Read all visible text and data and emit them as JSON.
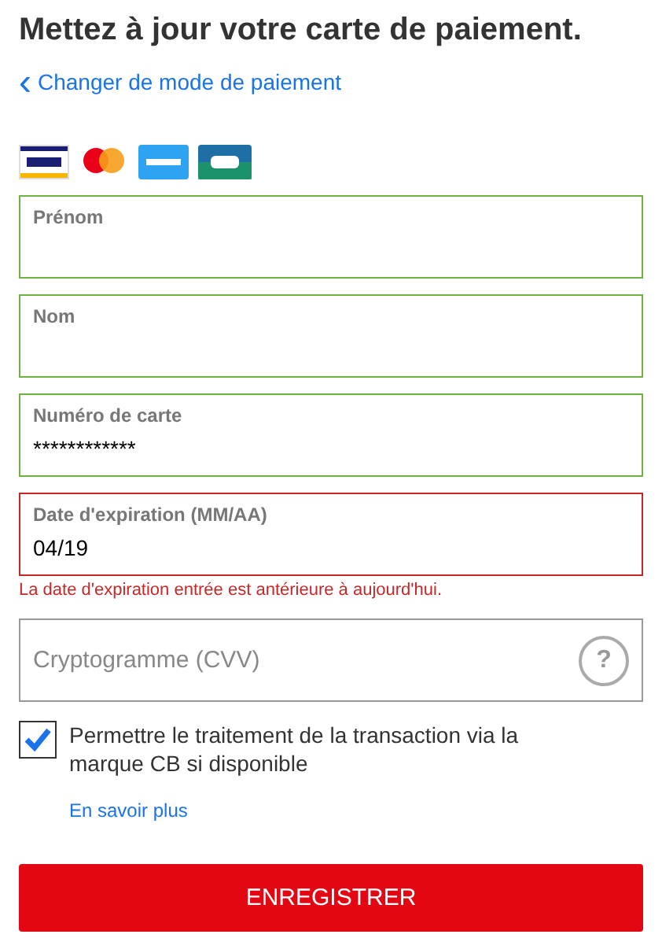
{
  "title": "Mettez à jour votre carte de paiement.",
  "back_link": {
    "icon": "‹",
    "label": "Changer de mode de paiement"
  },
  "fields": [
    {
      "label": "Prénom",
      "valid": true,
      "invalid": false
    },
    {
      "label": "Nom",
      "valid": true,
      "invalid": false
    },
    {
      "label": "Numéro de carte",
      "value": "************",
      "valid": true,
      "invalid": false
    },
    {
      "label": "Date d'expiration (MM/AA)",
      "value": "04/19",
      "valid": false,
      "invalid": true,
      "error": "La date d'expiration entrée est antérieure à aujourd'hui."
    },
    {
      "placeholder": "Cryptogramme (CVV)",
      "valid": false,
      "invalid": false,
      "help": "?"
    }
  ],
  "consent": {
    "label": "Permettre le traitement de la transaction via la marque CB si disponible",
    "checked": true
  },
  "more_link": "En savoir plus",
  "submit": "ENREGISTRER"
}
